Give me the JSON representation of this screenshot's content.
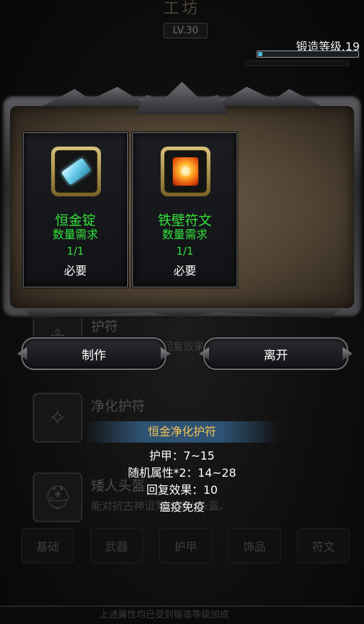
{
  "background": {
    "title": "工坊",
    "level_badge": "LV.30",
    "items": [
      {
        "name": "护符",
        "desc": "回复效果",
        "icon": "amulet-icon"
      },
      {
        "name": "净化护符",
        "desc": "",
        "icon": "purify-amulet-icon"
      },
      {
        "name": "矮人头盔",
        "desc": "能对抗古神诅咒的矮人头盔。",
        "icon": "helmet-icon"
      }
    ],
    "tabs": [
      "基础",
      "武器",
      "护甲",
      "饰品",
      "符文"
    ],
    "bottom_hint": "上述属性均已受到锻造等级加成"
  },
  "forge": {
    "label": "锻造等级.19",
    "progress": 0.04,
    "bar_color": "#49b6d9"
  },
  "materials": [
    {
      "name": "恒金锭",
      "requirement_label": "数量需求",
      "count": "1/1",
      "note": "必要",
      "icon": "ingot-icon"
    },
    {
      "name": "铁壁符文",
      "requirement_label": "数量需求",
      "count": "1/1",
      "note": "必要",
      "icon": "fire-rune-icon"
    }
  ],
  "buttons": {
    "craft": "制作",
    "leave": "离开"
  },
  "tooltip": {
    "title": "恒金净化护符",
    "lines": [
      "护甲：7~15",
      "随机属性*2：14~28",
      "回复效果：10",
      "瘟疫免疫"
    ]
  },
  "colors": {
    "material_text": "#33e23b",
    "tooltip_title": "#f4c454"
  }
}
